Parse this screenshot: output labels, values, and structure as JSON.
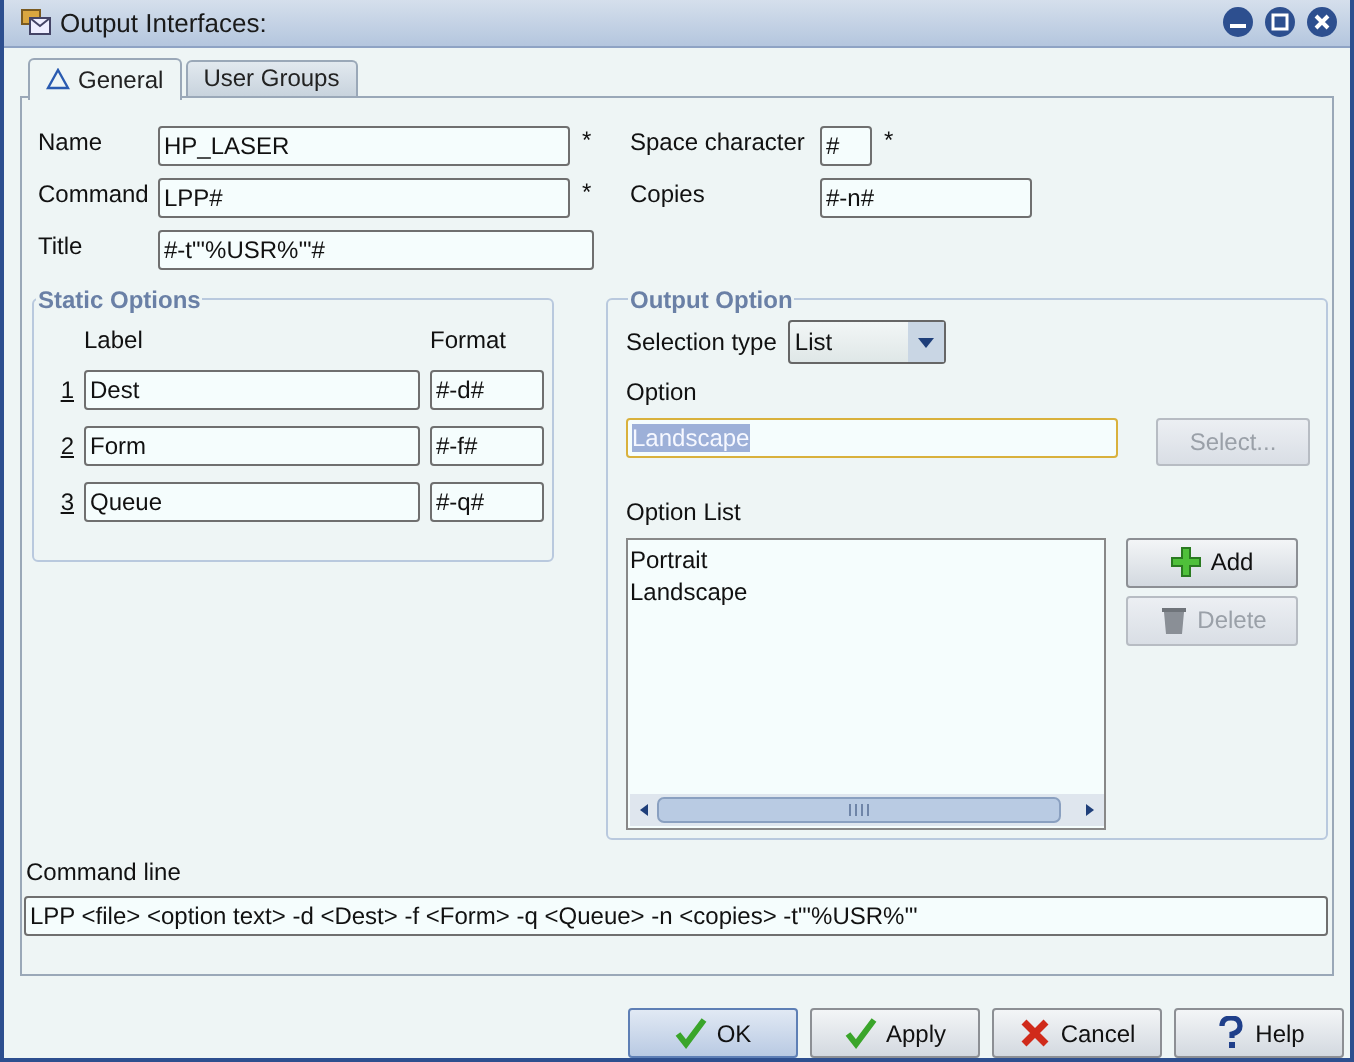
{
  "window": {
    "title": "Output Interfaces:"
  },
  "tabs": [
    {
      "label": "General",
      "selected": true
    },
    {
      "label": "User Groups",
      "selected": false
    }
  ],
  "fields": {
    "name": {
      "label": "Name",
      "value": "HP_LASER",
      "marker": "*"
    },
    "command": {
      "label": "Command",
      "value": "LPP#",
      "marker": "*"
    },
    "title": {
      "label": "Title",
      "value": "#-t\"'%USR%'\"#"
    },
    "space_character": {
      "label": "Space character",
      "value": "#",
      "marker": "*"
    },
    "copies": {
      "label": "Copies",
      "value": "#-n#"
    }
  },
  "static_options": {
    "title": "Static Options",
    "columns": [
      "Label",
      "Format"
    ],
    "rows": [
      {
        "number": "1",
        "label": "Dest",
        "format": "#-d#"
      },
      {
        "number": "2",
        "label": "Form",
        "format": "#-f#"
      },
      {
        "number": "3",
        "label": "Queue",
        "format": "#-q#"
      }
    ]
  },
  "output_option": {
    "title": "Output Option",
    "selection_type": {
      "label": "Selection type",
      "value": "List"
    },
    "option": {
      "label": "Option",
      "value": "Landscape",
      "highlighted": true
    },
    "select_button": {
      "label": "Select...",
      "disabled": true
    },
    "option_list": {
      "label": "Option List",
      "items": [
        "Portrait",
        "Landscape"
      ]
    },
    "buttons": [
      {
        "label": "Add",
        "kind": "add",
        "disabled": false
      },
      {
        "label": "Delete",
        "kind": "delete",
        "disabled": true
      }
    ]
  },
  "command_line": {
    "label": "Command line",
    "value": "LPP <file> <option text> -d <Dest> -f <Form> -q <Queue> -n <copies> -t\"'%USR%'\""
  },
  "buttons": [
    {
      "label": "OK",
      "kind": "ok",
      "default": true
    },
    {
      "label": "Apply",
      "kind": "apply",
      "default": false
    },
    {
      "label": "Cancel",
      "kind": "cancel",
      "default": false
    },
    {
      "label": "Help",
      "kind": "help",
      "default": false
    }
  ]
}
